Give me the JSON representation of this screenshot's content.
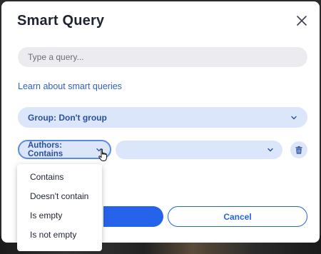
{
  "dialog": {
    "title": "Smart Query",
    "search": {
      "value": "",
      "placeholder": "Type a query..."
    },
    "learn_link": "Learn about smart queries",
    "group_select": {
      "label": "Group: Don't group"
    },
    "filter": {
      "field_label": "Authors: Contains",
      "value": ""
    },
    "operator_menu": {
      "items": [
        "Contains",
        "Doesn't contain",
        "Is empty",
        "Is not empty"
      ]
    },
    "buttons": {
      "ok_label": "",
      "cancel_label": "Cancel"
    },
    "colors": {
      "accent": "#2563eb",
      "pill_bg": "#dce6fa",
      "pill_text": "#2a4f9e"
    }
  }
}
